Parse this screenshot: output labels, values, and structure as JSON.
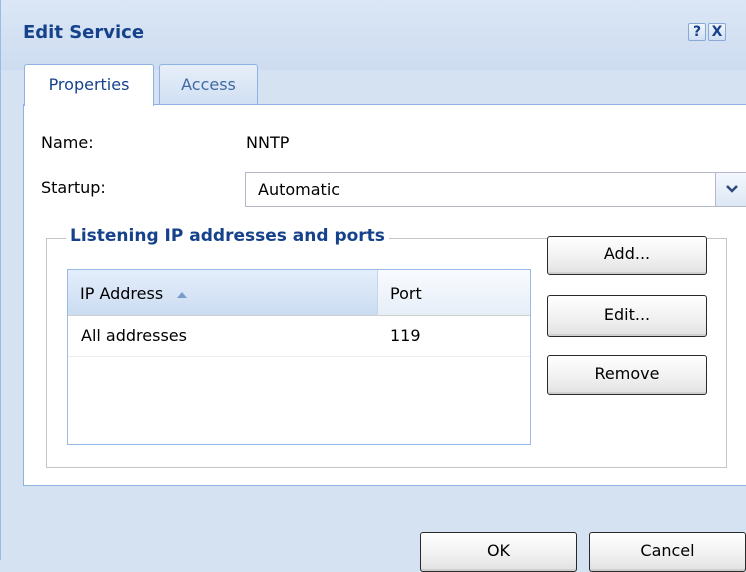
{
  "window": {
    "title": "Edit Service",
    "help_glyph": "?",
    "close_glyph": "X"
  },
  "tabs": [
    {
      "label": "Properties",
      "active": true
    },
    {
      "label": "Access",
      "active": false
    }
  ],
  "form": {
    "name_label": "Name:",
    "name_value": "NNTP",
    "startup_label": "Startup:",
    "startup_value": "Automatic"
  },
  "listening": {
    "legend": "Listening IP addresses and ports",
    "columns": [
      "IP Address",
      "Port"
    ],
    "sort": {
      "column": "IP Address",
      "direction": "ascending"
    },
    "rows": [
      {
        "ip": "All addresses",
        "port": "119"
      }
    ],
    "buttons": {
      "add": "Add...",
      "edit": "Edit...",
      "remove": "Remove"
    }
  },
  "footer": {
    "ok": "OK",
    "cancel": "Cancel"
  },
  "colors": {
    "title_text": "#15428b",
    "frame_bg": "#d5e2f2",
    "border_accent": "#8db2e3"
  },
  "icons": [
    "help-icon",
    "close-icon",
    "chevron-down-icon",
    "sort-ascending-icon"
  ]
}
